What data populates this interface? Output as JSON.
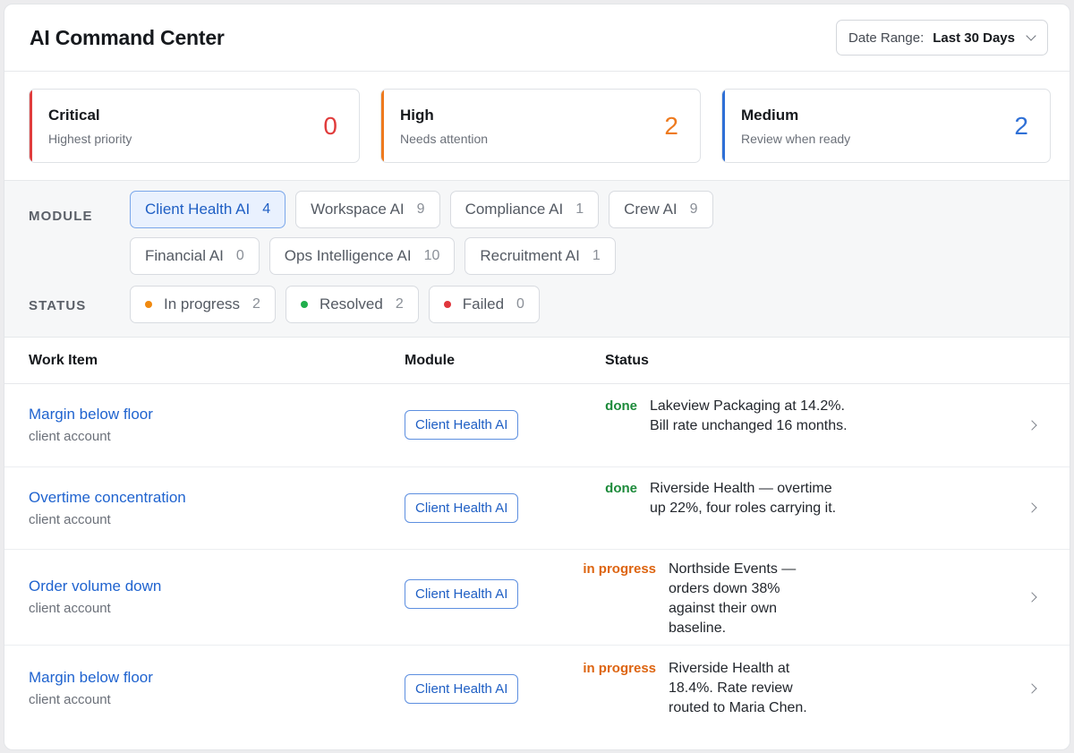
{
  "header": {
    "title": "AI Command Center",
    "date_range_label": "Date Range:",
    "date_range_value": "Last 30 Days"
  },
  "priority_cards": [
    {
      "title": "Critical",
      "subtitle": "Highest priority",
      "count": "0",
      "color": "#e03c3c"
    },
    {
      "title": "High",
      "subtitle": "Needs attention",
      "count": "2",
      "color": "#ee7a1e"
    },
    {
      "title": "Medium",
      "subtitle": "Review when ready",
      "count": "2",
      "color": "#2f70d6"
    }
  ],
  "filters": {
    "module_label": "MODULE",
    "status_label": "STATUS",
    "modules": [
      {
        "name": "Client Health AI",
        "count": "4",
        "active": true
      },
      {
        "name": "Workspace AI",
        "count": "9"
      },
      {
        "name": "Compliance AI",
        "count": "1"
      },
      {
        "name": "Crew AI",
        "count": "9"
      },
      {
        "name": "Financial AI",
        "count": "0"
      },
      {
        "name": "Ops Intelligence AI",
        "count": "10"
      },
      {
        "name": "Recruitment AI",
        "count": "1"
      }
    ],
    "statuses": [
      {
        "name": "In progress",
        "count": "2",
        "color": "#f0890f"
      },
      {
        "name": "Resolved",
        "count": "2",
        "color": "#1fae4b"
      },
      {
        "name": "Failed",
        "count": "0",
        "color": "#e0363c"
      }
    ]
  },
  "table": {
    "headers": {
      "item": "Work Item",
      "module": "Module",
      "status": "Status"
    },
    "rows": [
      {
        "title": "Margin below floor",
        "subtitle": "client account",
        "module": "Client Health AI",
        "status": "done",
        "description": "Lakeview Packaging at 14.2%. Bill rate unchanged 16 months."
      },
      {
        "title": "Overtime concentration",
        "subtitle": "client account",
        "module": "Client Health AI",
        "status": "done",
        "description": "Riverside Health — overtime up 22%, four roles carrying it."
      },
      {
        "title": "Order volume down",
        "subtitle": "client account",
        "module": "Client Health AI",
        "status": "in progress",
        "description": "Northside Events — orders down 38% against their own baseline."
      },
      {
        "title": "Margin below floor",
        "subtitle": "client account",
        "module": "Client Health AI",
        "status": "in progress",
        "description": "Riverside Health at 18.4%. Rate review routed to Maria Chen."
      }
    ]
  }
}
